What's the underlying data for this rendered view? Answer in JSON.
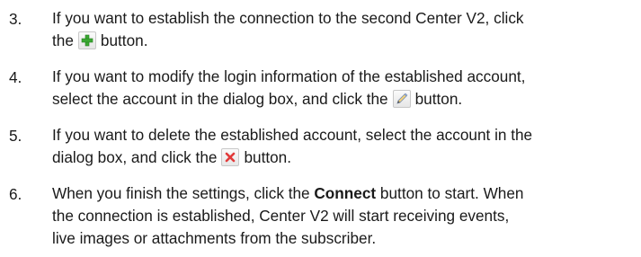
{
  "steps": [
    {
      "number": "3.",
      "lines": [
        {
          "text": "If you want to establish the connection to the second Center V2, click"
        },
        {
          "before": "the",
          "icon": "add-green-plus-icon",
          "after": "button."
        }
      ]
    },
    {
      "number": "4.",
      "lines": [
        {
          "text": "If you want to modify the login information of the established account,"
        },
        {
          "before": "select the account in the dialog box, and click the",
          "icon": "edit-pencil-icon",
          "after": "button."
        }
      ]
    },
    {
      "number": "5.",
      "lines": [
        {
          "text": "If you want to delete the established account, select the account in the"
        },
        {
          "before": "dialog box, and click the",
          "icon": "delete-red-x-icon",
          "after": "button."
        }
      ]
    },
    {
      "number": "6.",
      "lines": [
        {
          "before": "When you finish the settings, click the",
          "bold": "Connect",
          "after": "button to start. When"
        },
        {
          "text": "the connection is established, Center V2 will start receiving events,"
        },
        {
          "text": "live images or attachments from the subscriber."
        }
      ]
    }
  ],
  "colors": {
    "text": "#1a1a1a",
    "plus_icon": "#3aa832",
    "x_icon": "#e23a3a"
  }
}
